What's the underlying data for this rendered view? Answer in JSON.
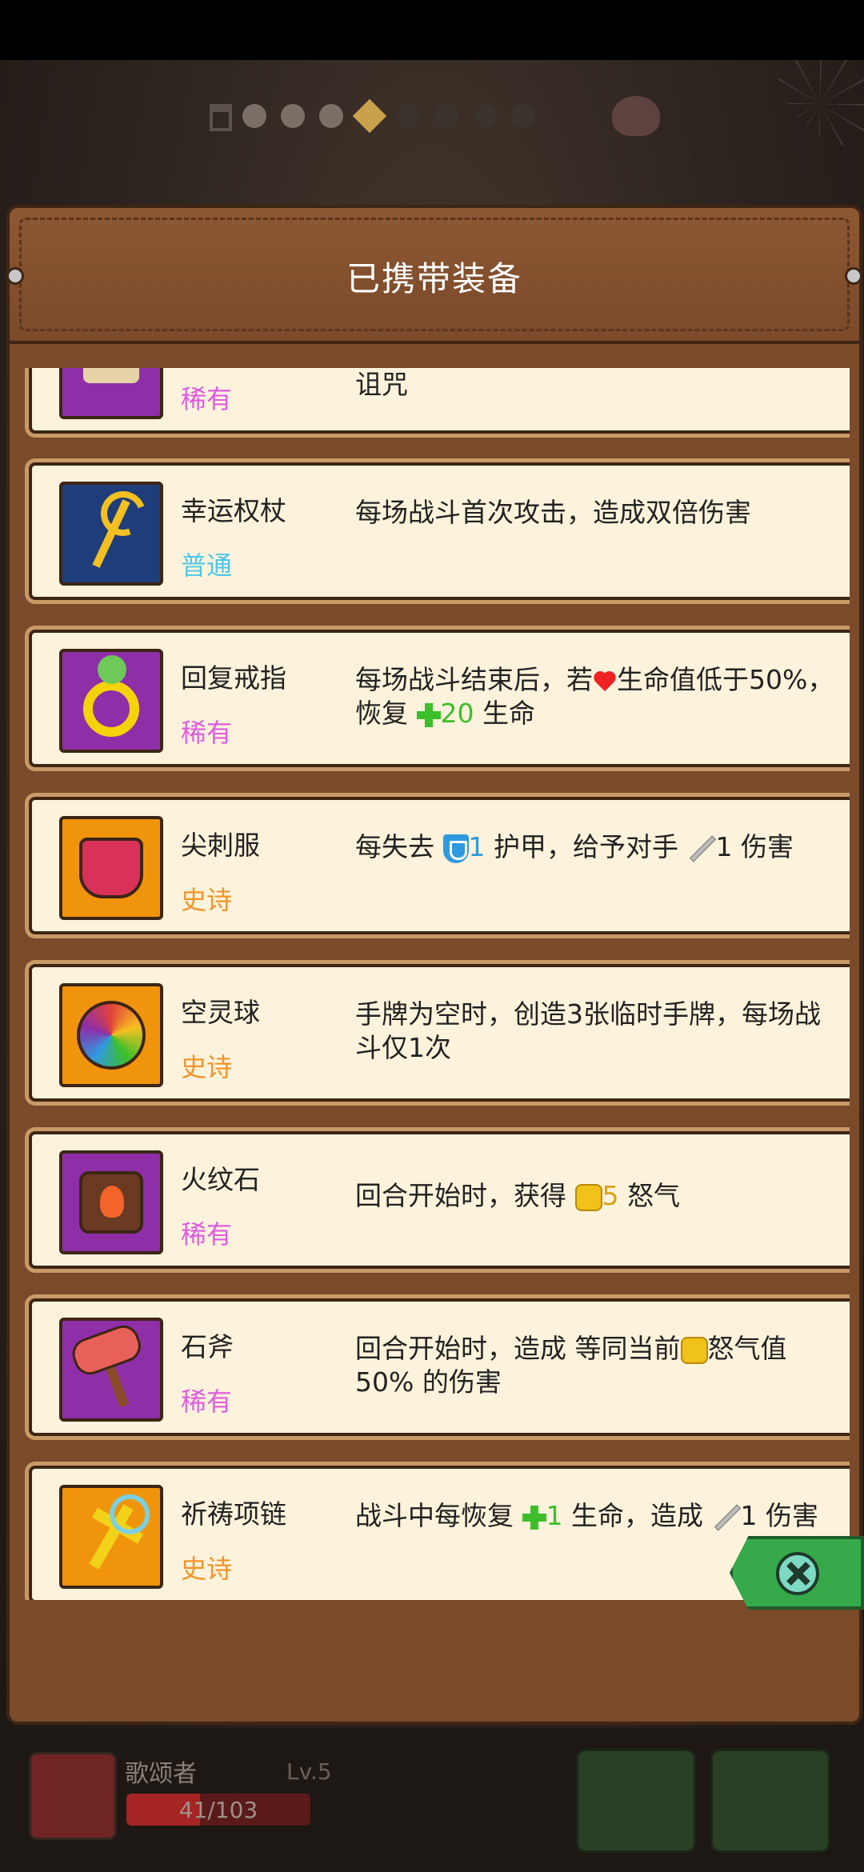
{
  "panel": {
    "title": "已携带装备"
  },
  "items": [
    {
      "name": "",
      "rarity": "稀有",
      "desc_text": "诅咒"
    },
    {
      "name": "幸运权杖",
      "rarity": "普通",
      "desc_text": "每场战斗首次攻击，造成双倍伤害"
    },
    {
      "name": "回复戒指",
      "rarity": "稀有",
      "desc_a": "每场战斗结束后，若",
      "desc_b": "生命值低于50%，恢复",
      "value": "20",
      "desc_c": "生命"
    },
    {
      "name": "尖刺服",
      "rarity": "史诗",
      "desc_a": "每失去",
      "value": "1",
      "desc_b": "护甲，给予对手",
      "value2": "1",
      "desc_c": "伤害"
    },
    {
      "name": "空灵球",
      "rarity": "史诗",
      "desc_text": "手牌为空时，创造3张临时手牌，每场战斗仅1次"
    },
    {
      "name": "火纹石",
      "rarity": "稀有",
      "desc_a": "回合开始时，获得",
      "value": "5",
      "desc_b": "怒气"
    },
    {
      "name": "石斧",
      "rarity": "稀有",
      "desc_a": "回合开始时，造成 等同当前",
      "desc_b": "怒气值50% 的伤害"
    },
    {
      "name": "祈祷项链",
      "rarity": "史诗",
      "desc_a": "战斗中每恢复",
      "value": "1",
      "desc_b": "生命，造成",
      "value2": "1",
      "desc_c": "伤害"
    }
  ],
  "player": {
    "name": "歌颂者",
    "level": "Lv.5",
    "hp_text": "41/103",
    "hp_fraction": 0.398
  },
  "colors": {
    "rare": "#de5ce0",
    "common": "#4cc8ea",
    "epic": "#f2942a",
    "panel": "#7a4a2a",
    "card": "#fdf3dc",
    "close_tab": "#36a94a"
  },
  "icons": [
    "heart-icon",
    "plus-icon",
    "shield-icon",
    "sword-icon",
    "fist-icon",
    "close-icon"
  ]
}
